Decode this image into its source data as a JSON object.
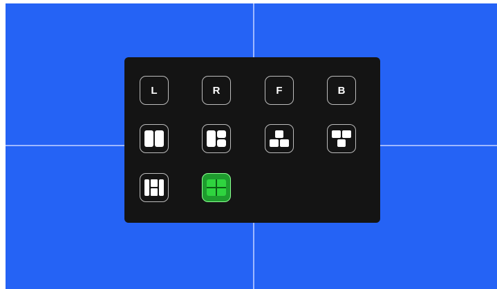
{
  "view_buttons": [
    {
      "label": "L",
      "name": "view-left-button"
    },
    {
      "label": "R",
      "name": "view-right-button"
    },
    {
      "label": "F",
      "name": "view-front-button"
    },
    {
      "label": "B",
      "name": "view-back-button"
    }
  ],
  "layout_buttons": [
    {
      "icon": "layout-two-columns-icon",
      "active": false
    },
    {
      "icon": "layout-one-plus-two-icon",
      "active": false
    },
    {
      "icon": "layout-one-top-two-bottom-icon",
      "active": false
    },
    {
      "icon": "layout-two-top-one-bottom-icon",
      "active": false
    },
    {
      "icon": "layout-three-columns-icon",
      "active": false
    },
    {
      "icon": "layout-quad-grid-icon",
      "active": true
    }
  ],
  "colors": {
    "viewport_background": "#2563f5",
    "panel_background": "#141414",
    "active_accent": "#1e9c2e",
    "active_border": "#8dff93"
  }
}
